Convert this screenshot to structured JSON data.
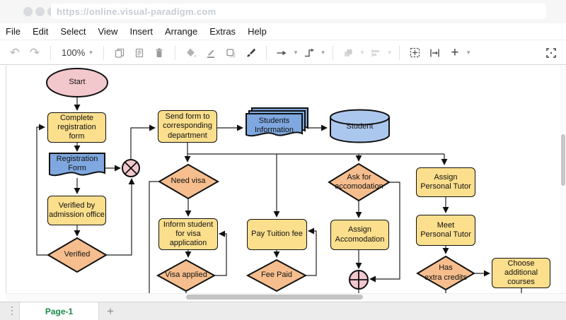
{
  "browser": {
    "url": "https://online.visual-paradigm.com"
  },
  "menu": {
    "items": [
      "File",
      "Edit",
      "Select",
      "View",
      "Insert",
      "Arrange",
      "Extras",
      "Help"
    ]
  },
  "toolbar": {
    "zoom_level": "100%",
    "glyphs": {
      "undo": "↶",
      "redo": "↷",
      "caret": "▾",
      "plus": "+",
      "kebab": "⋮"
    }
  },
  "diagram": {
    "nodes": {
      "start": "Start",
      "complete_registration": "Complete\nregistration form",
      "registration_form": "Registration\nForm",
      "verified_by": "Verified by\nadmission office",
      "verified": "Verified",
      "send_form": "Send form to\ncorresponding\ndepartment",
      "students_information": "Students\nInformation",
      "student": "Student",
      "need_visa": "Need visa",
      "inform_student": "Inform student\nfor visa\napplication",
      "visa_applied": "Visa applied",
      "pay_tuition": "Pay Tuition fee",
      "fee_paid": "Fee Paid",
      "ask_accomodation": "Ask for\naccomodation",
      "assign_accomodation": "Assign\nAccomodation",
      "assign_personal_tutor": "Assign\nPersonal Tutor",
      "meet_personal_tutor": "Meet\nPersonal Tutor",
      "has_extra_credits": "Has\nextra credits",
      "choose_courses": "Choose\nadditional\ncourses"
    },
    "colors": {
      "process_yellow": "#FBDF8D",
      "decision_orange": "#F6BE8E",
      "terminal_pink": "#F3C8CD",
      "data_blue": "#7FA8E0",
      "store_blue": "#ABC7EE",
      "line": "#222222"
    }
  },
  "footer": {
    "page_tab": "Page-1",
    "add_tab": "+"
  }
}
